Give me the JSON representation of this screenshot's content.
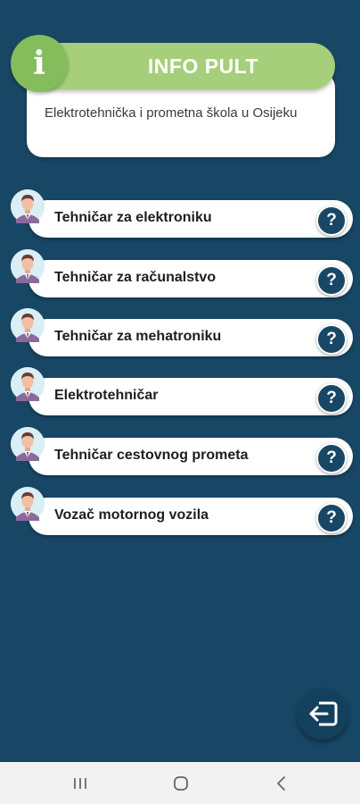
{
  "header": {
    "info_glyph": "i",
    "title": "INFO PULT",
    "subtitle": "Elektrotehnička i prometna škola u Osijeku"
  },
  "programs": [
    {
      "label": "Tehničar za elektroniku",
      "help": "?"
    },
    {
      "label": "Tehničar za računalstvo",
      "help": "?"
    },
    {
      "label": "Tehničar za mehatroniku",
      "help": "?"
    },
    {
      "label": "Elektrotehničar",
      "help": "?"
    },
    {
      "label": "Tehničar cestovnog prometa",
      "help": "?"
    },
    {
      "label": "Vozač motornog vozila",
      "help": "?"
    }
  ],
  "icons": {
    "avatar": "person-avatar-icon",
    "help": "question-icon",
    "exit": "exit-arrow-icon"
  },
  "colors": {
    "background": "#184766",
    "accent_green": "#a5cf7a",
    "info_green": "#85bd5d"
  }
}
